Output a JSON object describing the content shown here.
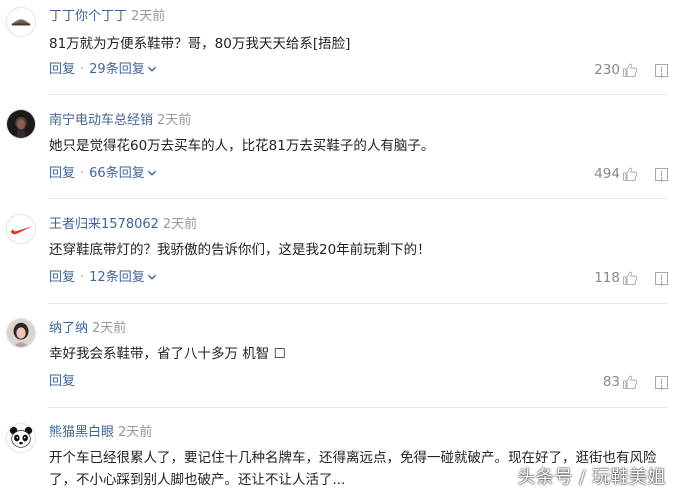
{
  "comments": [
    {
      "username": "丁丁你个丁丁",
      "time": "2天前",
      "content": "81万就为方便系鞋带？哥，80万我天天给系[捂脸]",
      "reply_label": "回复",
      "replies_label": "29条回复",
      "likes": "230",
      "avatar_icon": "hat-avatar-icon"
    },
    {
      "username": "南宁电动车总经销",
      "time": "2天前",
      "content": "她只是觉得花60万去买车的人，比花81万去买鞋子的人有脑子。",
      "reply_label": "回复",
      "replies_label": "66条回复",
      "likes": "494",
      "avatar_icon": "dark-portrait-avatar-icon"
    },
    {
      "username": "王者归来1578062",
      "time": "2天前",
      "content": "还穿鞋底带灯的？我骄傲的告诉你们，这是我20年前玩剩下的！",
      "reply_label": "回复",
      "replies_label": "12条回复",
      "likes": "118",
      "avatar_icon": "swoosh-logo-avatar-icon"
    },
    {
      "username": "纳了纳",
      "time": "2天前",
      "content": "幸好我会系鞋带，省了八十多万 机智 ☐",
      "reply_label": "回复",
      "likes": "83",
      "avatar_icon": "photo-avatar-icon"
    },
    {
      "username": "熊猫黑白眼",
      "time": "2天前",
      "content": "开个车已经很累人了，要记住十几种名牌车，还得离远点，免得一碰就破产。现在好了，逛街也有风险了，不小心踩到别人脚也破产。还让不让人活了...",
      "avatar_icon": "panda-avatar-icon"
    }
  ],
  "watermark": "头条号 / 玩鞋美姐",
  "colors": {
    "link_blue": "#406599",
    "meta_gray": "#999999",
    "body_text": "#222222",
    "separator": "#e8e8e8"
  }
}
